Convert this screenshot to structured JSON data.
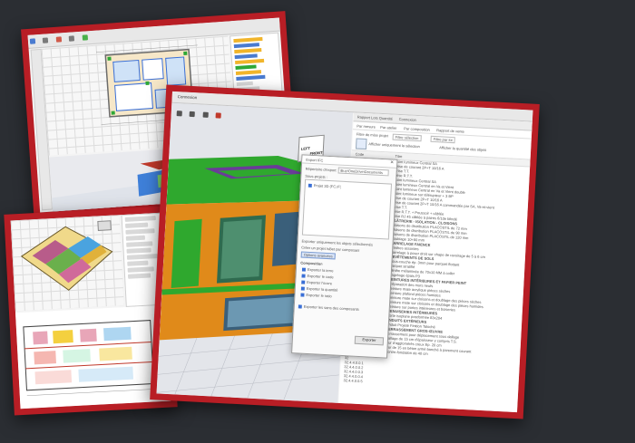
{
  "card3": {
    "window_title": "Connexion",
    "tabs": [
      "Rapport Lots Quantité",
      "Connexion"
    ],
    "subtabs": [
      "Par mesure",
      "Par atelier",
      "Par composition",
      "Rapport de vente"
    ],
    "filter_label": "Filtre de mise projet",
    "filter_value": "Filtre sélection",
    "filter_extra": "Filtre par lot",
    "checkbox_1": "Afficher uniquement la sélection",
    "checkbox_2": "Afficher la quantité des objets",
    "col_code": "Code",
    "col_title": "Titre",
    "lines": [
      "Point lumineux Central SA",
      "Prise de courant 2P+T 10/16 A",
      "Prise T.T.",
      "Prise R.T.T.",
      "Point lumineux Central SA",
      "Point lumineux Central en Va et Vient",
      "Point lumineux Central en Va et Vient double",
      "Point lumineux sur télérupteur + 3 BP",
      "Prise de courant 2P+T 10/16 A",
      "Prise de courant 2P+T 10/16 A commandée par SA, Va-et-vient",
      "Prise T.T.",
      "Prise R.T.T. + Poussoir + câblée",
      "Prise RJ 45 câblée à paires 6/10e blindé",
      "PLÂTRERIE - ISOLATION - CLOISONS",
      "Cloisons de distribution PLACOSTIL de 72 mm",
      "Cloisons de distribution PLACOSTIL de 98 mm",
      "Cloisons de distribution PLACOSTIL de 120 mm",
      "Doublage 10+80 mm",
      "CARRELAGE FAIENCE",
      "Plinthes assorties",
      "Carrelage à poser droit sur chape de ravoirage de 5 à 6 cm",
      "REVÊTEMENTS DE SOLS",
      "Sous-couche ép. 3mm pour parquet flottant",
      "Parquet stratifié",
      "Plinthe mélaminée de 70x10 MM à coller",
      "Ragréage épais P3",
      "PEINTURES INTÉRIEURES ET PAPIER PEINT",
      "Préparation des murs neufs",
      "Peinture mate acrylique pièces sèches",
      "Peinture plafond pièces humides",
      "Peinture mate sur cloisons et doublage des pièces sèches",
      "Peinture mate sur cloisons et doublage des pièces humides",
      "Peinture sur portes intérieures et boiseries",
      "MENUISERIES INTÉRIEURES",
      "Porte isoplane postformée 83x204",
      "ENDUITS EXTÉRIEURS",
      "Enduit Projeté Finition Taloché",
      "TERRASSEMENT GROS-ŒUVRE",
      "Terrassement pour déplacement sous dallage",
      "Dallage de 15 cm d'épaisseur y compris T.S.",
      "Mur d'agglomérés creux Ep. 20 cm",
      "Mur de 15 en béton armé banché à parement courant",
      "Contre-fondation de 40 cm"
    ],
    "codes": [
      "27.1.1.1",
      "27.1.2.2",
      "32",
      "32.4.4.0.0.1",
      "32.4.4.0.0.2",
      "32.4.4.0.0.3",
      "32.4.4.0.0.4",
      "32.4.4.0.0.5"
    ],
    "dialog": {
      "title": "Export IFC",
      "label_path": "Répertoire d'export",
      "path_value": "\\Buy\\OneDrive\\Documents",
      "label_select": "Sous-projets :",
      "tree_item": "Projet 3D (FC.IF)",
      "opt1": "Exporter uniquement les objets sélectionnés",
      "opt2": "Créer un projet IsBet par composant",
      "opt3": "Options avancées",
      "section": "Composition",
      "checks": [
        "Exporter la terre",
        "Exporter le code",
        "Exporter l'ouvre",
        "Exporter la quantité",
        "Exporter le ratio"
      ],
      "opt4": "Exporter les sans des composants",
      "export_button": "Exporter"
    },
    "cube_labels": [
      "LEFT",
      "FRONT"
    ]
  },
  "colors": {
    "frame": "#b81e25",
    "background": "#2b2e33",
    "roof_green": "#43b52e",
    "wall_orange": "#e08a1a",
    "accent_blue": "#3a6fd6"
  }
}
